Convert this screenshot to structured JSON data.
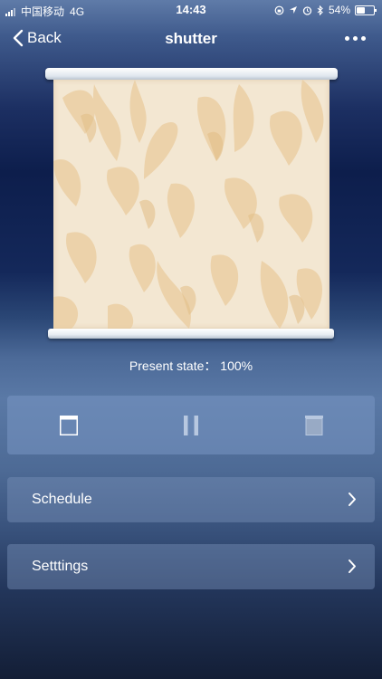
{
  "status_bar": {
    "carrier": "中国移动",
    "network": "4G",
    "time": "14:43",
    "battery_percent": "54%",
    "battery_level": 0.54
  },
  "nav": {
    "back_label": "Back",
    "title": "shutter",
    "more_icon": "ellipsis-icon"
  },
  "blind": {
    "fabric_color": "#f3e7d2",
    "leaf_color": "#ebcfa4"
  },
  "state": {
    "text": "Present state：  100%",
    "position_percent": 100
  },
  "controls": {
    "open_icon": "blind-open-icon",
    "pause_icon": "pause-icon",
    "close_icon": "blind-close-icon"
  },
  "menu": {
    "schedule_label": "Schedule",
    "settings_label": "Setttings"
  }
}
